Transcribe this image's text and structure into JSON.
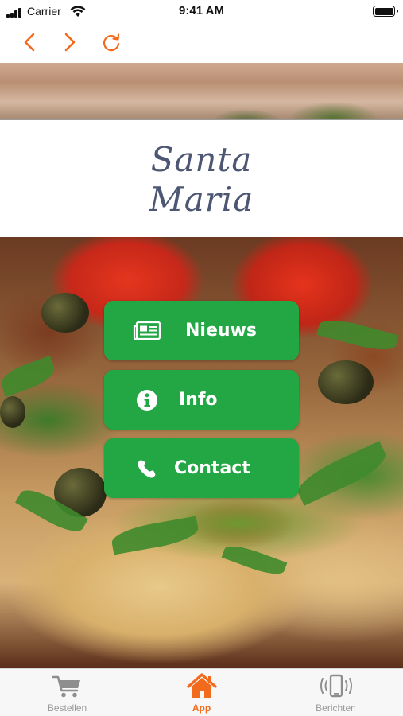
{
  "status_bar": {
    "carrier": "Carrier",
    "time": "9:41 AM"
  },
  "nav": {
    "back_icon": "chevron-left-icon",
    "forward_icon": "chevron-right-icon",
    "reload_icon": "reload-icon",
    "accent_color": "#f26b1d"
  },
  "title": {
    "line1": "Santa",
    "line2": "Maria",
    "color": "#4d5774"
  },
  "menu": {
    "button_color": "#23a745",
    "items": [
      {
        "label": "Nieuws",
        "icon": "newspaper-icon"
      },
      {
        "label": "Info",
        "icon": "info-icon"
      },
      {
        "label": "Contact",
        "icon": "phone-icon"
      }
    ]
  },
  "tab_bar": {
    "active_color": "#f26b1d",
    "inactive_color": "#9a9a9a",
    "tabs": [
      {
        "label": "Bestellen",
        "icon": "cart-icon",
        "active": false
      },
      {
        "label": "App",
        "icon": "home-icon",
        "active": true
      },
      {
        "label": "Berichten",
        "icon": "phone-vibrate-icon",
        "active": false
      }
    ]
  }
}
